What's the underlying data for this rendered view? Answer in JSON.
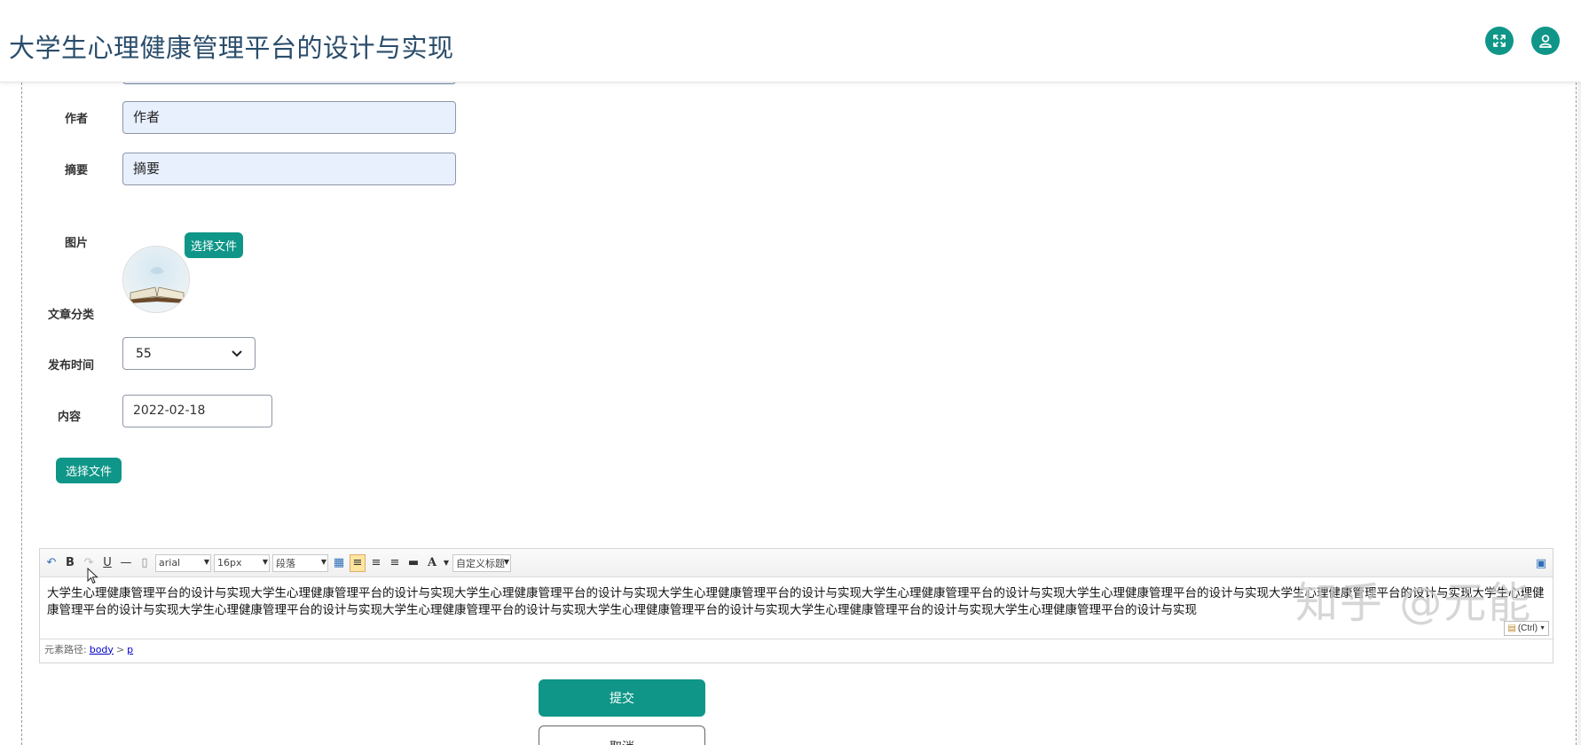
{
  "header": {
    "title": "大学生心理健康管理平台的设计与实现",
    "fullscreen_icon": "expand-icon",
    "user_icon": "user-icon"
  },
  "form": {
    "author": {
      "label": "作者",
      "value": "作者"
    },
    "summary": {
      "label": "摘要",
      "value": "摘要"
    },
    "image": {
      "label": "图片",
      "button": "选择文件"
    },
    "category": {
      "label": "文章分类",
      "value": "55"
    },
    "publish_time": {
      "label": "发布时间",
      "value": "2022-02-18"
    },
    "content": {
      "label": "内容",
      "file_button": "选择文件"
    }
  },
  "editor": {
    "font_family": "arial",
    "font_size": "16px",
    "paragraph": "段落",
    "custom_title": "自定义标题",
    "text": "大学生心理健康管理平台的设计与实现大学生心理健康管理平台的设计与实现大学生心理健康管理平台的设计与实现大学生心理健康管理平台的设计与实现大学生心理健康管理平台的设计与实现大学生心理健康管理平台的设计与实现大学生心理健康管理平台的设计与实现大学生心理健康管理平台的设计与实现大学生心理健康管理平台的设计与实现大学生心理健康管理平台的设计与实现大学生心理健康管理平台的设计与实现大学生心理健康管理平台的设计与实现大学生心理健康管理平台的设计与实现",
    "paste_label": "(Ctrl)",
    "path_label": "元素路径:",
    "path_body": "body",
    "path_sep": ">",
    "path_p": "p"
  },
  "actions": {
    "submit": "提交",
    "cancel": "取消"
  },
  "watermark": "知乎 @元能",
  "colors": {
    "accent": "#0f9688",
    "title": "#2a4d6b",
    "input_bg": "#e8f0fe"
  }
}
